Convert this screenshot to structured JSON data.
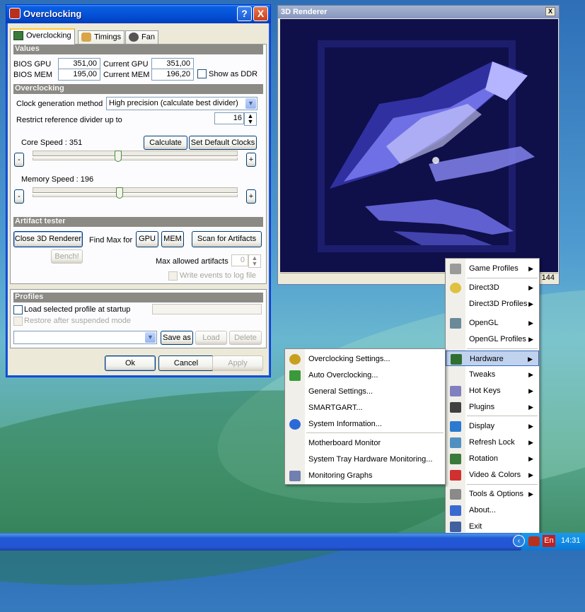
{
  "overclock_window": {
    "title": "Overclocking",
    "help_btn": "?",
    "close_btn": "X",
    "tabs": [
      {
        "label": "Overclocking",
        "active": true
      },
      {
        "label": "Timings",
        "active": false
      },
      {
        "label": "Fan",
        "active": false
      }
    ],
    "values": {
      "header": "Values",
      "bios_gpu_label": "BIOS GPU",
      "bios_gpu": "351,00",
      "current_gpu_label": "Current GPU",
      "current_gpu": "351,00",
      "bios_mem_label": "BIOS MEM",
      "bios_mem": "195,00",
      "current_mem_label": "Current MEM",
      "current_mem": "196,20",
      "show_ddr": "Show as DDR"
    },
    "overclocking": {
      "header": "Overclocking",
      "clock_method_label": "Clock generation method",
      "clock_method": "High precision (calculate best divider)",
      "restrict_label": "Restrict reference divider up to",
      "restrict_value": "16",
      "core_speed_label": "Core Speed : 351",
      "core_level": 0.41,
      "memory_speed_label": "Memory Speed : 196",
      "memory_level": 0.42,
      "calculate": "Calculate",
      "set_default": "Set Default Clocks",
      "minus": "-",
      "plus": "+"
    },
    "artifact": {
      "header": "Artifact tester",
      "close_renderer": "Close 3D Renderer",
      "find_max": "Find Max for",
      "gpu": "GPU",
      "mem": "MEM",
      "scan": "Scan for Artifacts",
      "bench": "Bench!",
      "max_allowed_label": "Max allowed artifacts",
      "max_allowed": "0",
      "write_events": "Write events to log file"
    },
    "profiles": {
      "header": "Profiles",
      "load_startup": "Load selected profile at startup",
      "restore": "Restore after suspended mode",
      "save_as": "Save as",
      "load": "Load",
      "delete": "Delete"
    },
    "footer": {
      "ok": "Ok",
      "cancel": "Cancel",
      "apply": "Apply"
    }
  },
  "renderer_window": {
    "title": "3D Renderer",
    "close_btn": "X",
    "fps": "144"
  },
  "main_menu": {
    "items": [
      {
        "label": "Game Profiles",
        "icon": "gamepad-icon",
        "sub": true
      },
      {
        "label": "Direct3D",
        "icon": "direct3d-icon",
        "sub": true
      },
      {
        "label": "Direct3D Profiles",
        "icon": "",
        "sub": true
      },
      {
        "label": "OpenGL",
        "icon": "opengl-icon",
        "sub": true
      },
      {
        "label": "OpenGL Profiles",
        "icon": "",
        "sub": true
      },
      {
        "label": "Hardware",
        "icon": "hardware-icon",
        "sub": true,
        "selected": true
      },
      {
        "label": "Tweaks",
        "icon": "",
        "sub": true
      },
      {
        "label": "Hot Keys",
        "icon": "hotkeys-icon",
        "sub": true
      },
      {
        "label": "Plugins",
        "icon": "plugins-icon",
        "sub": true
      },
      {
        "label": "Display",
        "icon": "display-icon",
        "sub": true
      },
      {
        "label": "Refresh Lock",
        "icon": "refresh-lock-icon",
        "sub": true
      },
      {
        "label": "Rotation",
        "icon": "rotation-icon",
        "sub": true
      },
      {
        "label": "Video & Colors",
        "icon": "video-colors-icon",
        "sub": true
      },
      {
        "label": "Tools & Options",
        "icon": "tools-icon",
        "sub": true
      },
      {
        "label": "About...",
        "icon": "about-icon",
        "sub": false
      },
      {
        "label": "Exit",
        "icon": "exit-icon",
        "sub": false
      }
    ]
  },
  "hardware_submenu": {
    "items": [
      {
        "label": "Overclocking Settings...",
        "icon": "overclocking-icon"
      },
      {
        "label": "Auto Overclocking...",
        "icon": "auto-overclocking-icon"
      },
      {
        "label": "General Settings...",
        "icon": ""
      },
      {
        "label": "SMARTGART...",
        "icon": ""
      },
      {
        "label": "System Information...",
        "icon": "info-icon"
      },
      {
        "label": "Motherboard Monitor",
        "icon": ""
      },
      {
        "label": "System Tray Hardware Monitoring...",
        "icon": ""
      },
      {
        "label": "Monitoring Graphs",
        "icon": "graphs-icon"
      }
    ]
  },
  "taskbar": {
    "lang": "En",
    "clock": "14:31"
  },
  "colors": {
    "accent": "#0553d8",
    "menu_highlight": "#c1d2ee",
    "renderer_bg": "#0f0f4a"
  }
}
